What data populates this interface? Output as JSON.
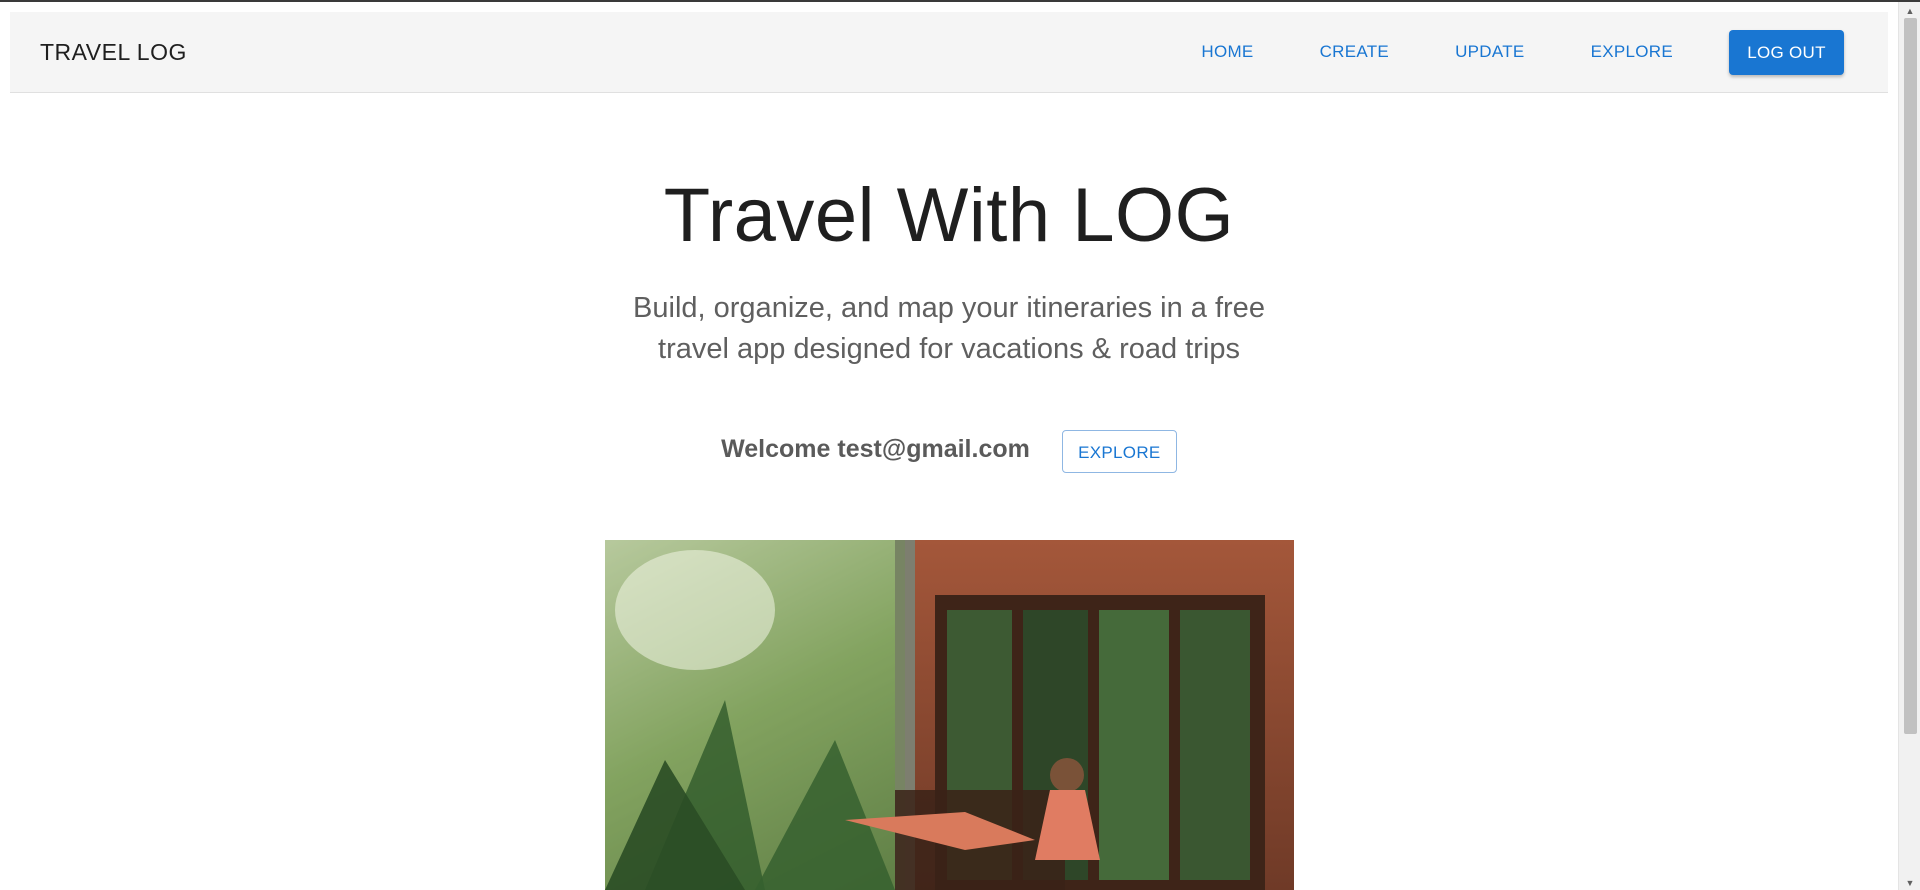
{
  "header": {
    "brand": "TRAVEL LOG",
    "nav": {
      "home": "HOME",
      "create": "CREATE",
      "update": "UPDATE",
      "explore": "EXPLORE",
      "logout": "LOG OUT"
    }
  },
  "hero": {
    "title": "Travel With LOG",
    "subtitle": "Build, organize, and map your itineraries in a free travel app designed for vacations & road trips",
    "welcome": "Welcome test@gmail.com",
    "explore_button": "EXPLORE"
  },
  "colors": {
    "primary": "#1976d2",
    "appbar": "#f5f5f5"
  },
  "icons": {
    "scroll_up": "triangle-up-icon",
    "scroll_down": "triangle-down-icon"
  }
}
